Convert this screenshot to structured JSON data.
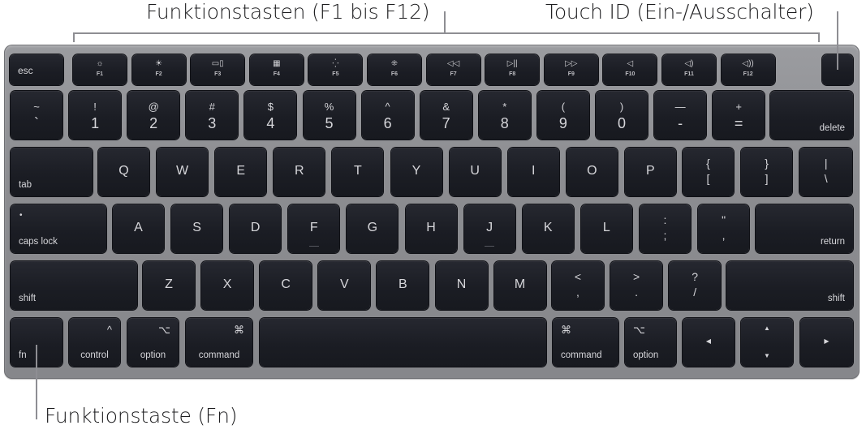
{
  "callouts": {
    "function_keys": "Funktionstasten (F1 bis F12)",
    "touch_id": "Touch ID (Ein-/Ausschalter)",
    "fn_key": "Funktionstaste (Fn)"
  },
  "keyboard": {
    "function_row": {
      "esc": "esc",
      "keys": [
        {
          "icon": "☼",
          "icon_name": "brightness-down-icon",
          "label": "F1"
        },
        {
          "icon": "☀",
          "icon_name": "brightness-up-icon",
          "label": "F2"
        },
        {
          "icon": "▭▯",
          "icon_name": "mission-control-icon",
          "label": "F3"
        },
        {
          "icon": "▦",
          "icon_name": "launchpad-icon",
          "label": "F4"
        },
        {
          "icon": "⁛",
          "icon_name": "keyboard-backlight-down-icon",
          "label": "F5"
        },
        {
          "icon": "⁜",
          "icon_name": "keyboard-backlight-up-icon",
          "label": "F6"
        },
        {
          "icon": "◁◁",
          "icon_name": "rewind-icon",
          "label": "F7"
        },
        {
          "icon": "▷||",
          "icon_name": "play-pause-icon",
          "label": "F8"
        },
        {
          "icon": "▷▷",
          "icon_name": "fast-forward-icon",
          "label": "F9"
        },
        {
          "icon": "◁",
          "icon_name": "mute-icon",
          "label": "F10"
        },
        {
          "icon": "◁)",
          "icon_name": "volume-down-icon",
          "label": "F11"
        },
        {
          "icon": "◁))",
          "icon_name": "volume-up-icon",
          "label": "F12"
        }
      ],
      "touch_id": ""
    },
    "number_row": {
      "keys": [
        {
          "top": "~",
          "bottom": "`"
        },
        {
          "top": "!",
          "bottom": "1"
        },
        {
          "top": "@",
          "bottom": "2"
        },
        {
          "top": "#",
          "bottom": "3"
        },
        {
          "top": "$",
          "bottom": "4"
        },
        {
          "top": "%",
          "bottom": "5"
        },
        {
          "top": "^",
          "bottom": "6"
        },
        {
          "top": "&",
          "bottom": "7"
        },
        {
          "top": "*",
          "bottom": "8"
        },
        {
          "top": "(",
          "bottom": "9"
        },
        {
          "top": ")",
          "bottom": "0"
        },
        {
          "top": "—",
          "bottom": "-"
        },
        {
          "top": "+",
          "bottom": "="
        }
      ],
      "delete": "delete"
    },
    "top_row": {
      "tab": "tab",
      "letters": [
        "Q",
        "W",
        "E",
        "R",
        "T",
        "Y",
        "U",
        "I",
        "O",
        "P"
      ],
      "brackets": [
        {
          "top": "{",
          "bottom": "["
        },
        {
          "top": "}",
          "bottom": "]"
        },
        {
          "top": "|",
          "bottom": "\\"
        }
      ]
    },
    "home_row": {
      "caps_lock": "caps lock",
      "caps_indicator": "•",
      "letters": [
        "A",
        "S",
        "D",
        "F",
        "G",
        "H",
        "J",
        "K",
        "L"
      ],
      "punct": [
        {
          "top": ":",
          "bottom": ";"
        },
        {
          "top": "\"",
          "bottom": ","
        }
      ],
      "return": "return"
    },
    "bottom_row": {
      "shift_left": "shift",
      "letters": [
        "Z",
        "X",
        "C",
        "V",
        "B",
        "N",
        "M"
      ],
      "punct": [
        {
          "top": "<",
          "bottom": ","
        },
        {
          "top": ">",
          "bottom": "."
        },
        {
          "top": "?",
          "bottom": "/"
        }
      ],
      "shift_right": "shift"
    },
    "modifier_row": {
      "fn": "fn",
      "control": {
        "symbol": "^",
        "label": "control"
      },
      "option_left": {
        "symbol": "⌥",
        "label": "option"
      },
      "command_left": {
        "symbol": "⌘",
        "label": "command"
      },
      "space": "",
      "command_right": {
        "symbol": "⌘",
        "label": "command"
      },
      "option_right": {
        "symbol": "⌥",
        "label": "option"
      },
      "arrows": {
        "left": "◀",
        "up": "▲",
        "down": "▼",
        "right": "▶"
      }
    }
  }
}
